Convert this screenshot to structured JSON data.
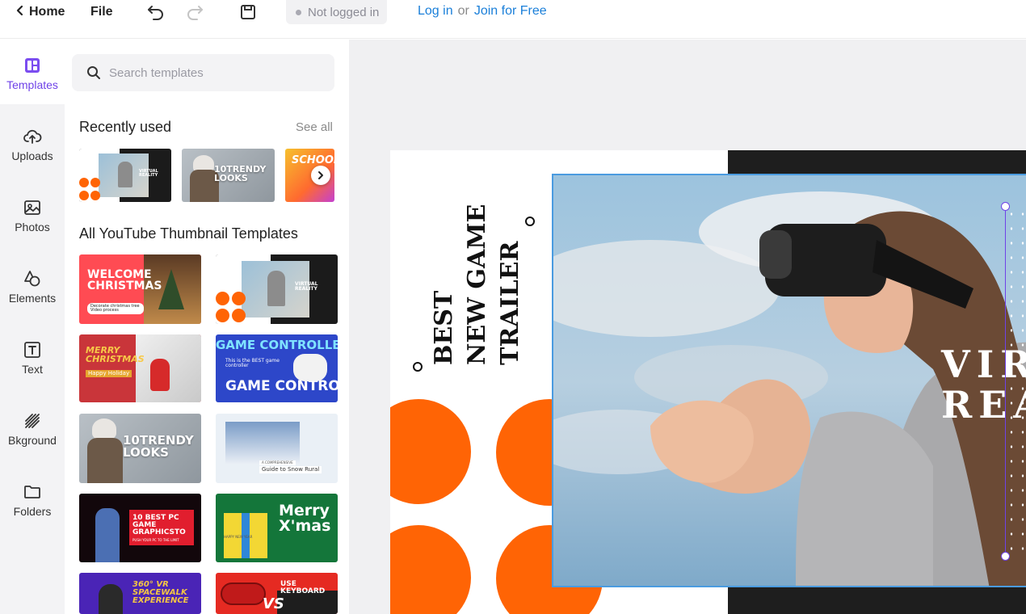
{
  "topbar": {
    "home_label": "Home",
    "file_label": "File",
    "status_label": "Not logged in",
    "login_label": "Log in",
    "or_label": "or",
    "join_label": "Join for Free"
  },
  "rail": {
    "items": [
      {
        "label": "Templates",
        "icon": "templates-icon",
        "active": true
      },
      {
        "label": "Uploads",
        "icon": "cloud-upload-icon"
      },
      {
        "label": "Photos",
        "icon": "image-icon"
      },
      {
        "label": "Elements",
        "icon": "shapes-icon"
      },
      {
        "label": "Text",
        "icon": "text-icon"
      },
      {
        "label": "Bkground",
        "icon": "background-icon"
      },
      {
        "label": "Folders",
        "icon": "folder-icon"
      }
    ]
  },
  "panel": {
    "search_placeholder": "Search templates",
    "recent_title": "Recently used",
    "see_all": "See all",
    "all_title": "All YouTube Thumbnail Templates",
    "recent": [
      {
        "name": "Virtual Reality",
        "text": "VIRTUAL REALITY"
      },
      {
        "name": "10 Trendy Looks",
        "text": "10TRENDY LOOKS"
      },
      {
        "name": "School",
        "text": "SCHOOL"
      }
    ],
    "templates": [
      {
        "text": "WELCOME CHRISTMAS",
        "sub": "Decorate christmas tree Video process"
      },
      {
        "text": "VIRTUAL REALITY",
        "sub": ""
      },
      {
        "text": "MERRY CHRISTMAS",
        "sub": "Happy Holiday"
      },
      {
        "text": "GAME CONTROLLERS",
        "sub": "This is the BEST game controller",
        "text2": "GAME CONTROLLE"
      },
      {
        "text": "10TRENDY LOOKS",
        "sub": ""
      },
      {
        "text": "Guide to Snow Rural",
        "sub": "A COMPREHENSIVE"
      },
      {
        "text": "10 BEST PC GAME GRAPHICSTO",
        "sub": "PUSH YOUR PC TO THE LIMIT"
      },
      {
        "text": "Merry X'mas",
        "sub": "HAPPY NEW YEAR"
      },
      {
        "text": "360° VR SPACEWALK EXPERIENCE",
        "sub": ""
      },
      {
        "text": "USE KEYBOARD",
        "sub": "VS"
      }
    ]
  },
  "canvas": {
    "title_line1": "BEST",
    "title_line2": "NEW GAME",
    "title_line3": "TRAILER",
    "photo_text_1": "VIR",
    "photo_text_2": "REA"
  },
  "colors": {
    "accent": "#6f42e8",
    "orange": "#ff6405",
    "link": "#1a7fd9"
  }
}
